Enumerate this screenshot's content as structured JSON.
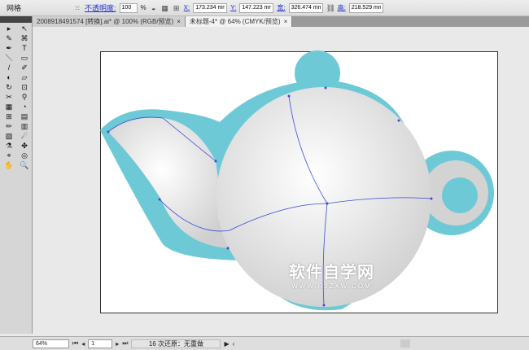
{
  "control_bar": {
    "panel": "网格",
    "opacity_label": "不透明度:",
    "opacity_value": "100",
    "opacity_unit": "%",
    "x_label": "X:",
    "x_value": "173.234 mm",
    "y_label": "Y:",
    "y_value": "147.223 mm",
    "w_label": "宽:",
    "w_value": "326.474 mm",
    "h_label": "高:",
    "h_value": "218.529 mm"
  },
  "tabs": [
    {
      "label": "2008918491574 [转换].ai* @ 100% (RGB/预览)"
    },
    {
      "label": "未标题-4* @ 64% (CMYK/预览)"
    }
  ],
  "tools": [
    "▸",
    "↖",
    "✎",
    "⌘",
    "✒",
    "T",
    "＼",
    "▭",
    "/",
    "✐",
    "◐",
    "▱",
    "↻",
    "⊡",
    "✂",
    "⚲",
    "▦",
    "◔",
    "⊞",
    "▤",
    "✏",
    "▥",
    "▨",
    "☄",
    "⚗",
    "✤",
    "⌖",
    "◎",
    "✋",
    "🔍"
  ],
  "status": {
    "zoom": "64%",
    "page": "1",
    "history": "16 次还原：无重做"
  },
  "watermark": {
    "title": "软件自学网",
    "url": "WWW.RJZXW.COM"
  },
  "colors": {
    "teapot_outline": "#6ec9d6",
    "body": "#e2e2e2",
    "path": "#3a4bd8"
  }
}
